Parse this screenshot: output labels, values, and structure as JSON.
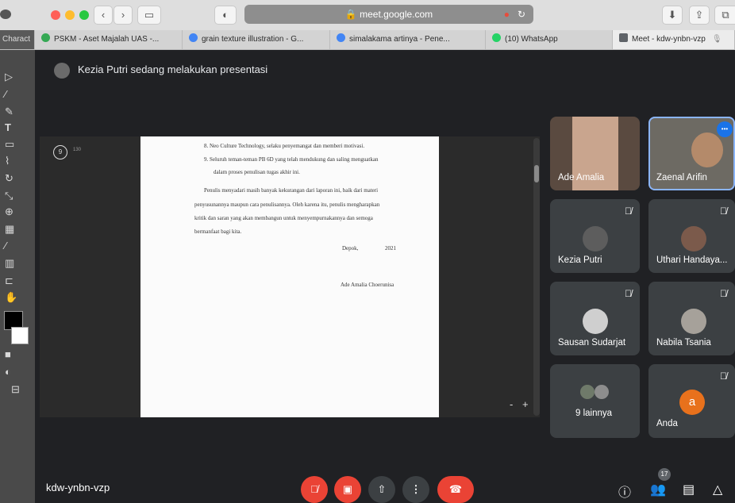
{
  "browser": {
    "url": "meet.google.com",
    "tabs": [
      {
        "label": "PSKM - Aset Majalah UAS -...",
        "icon": "drive-icon",
        "color": "#34a853"
      },
      {
        "label": "grain texture illustration - G...",
        "icon": "google-icon",
        "color": "#4285f4"
      },
      {
        "label": "simalakama artinya - Pene...",
        "icon": "google-icon",
        "color": "#4285f4"
      },
      {
        "label": "(10) WhatsApp",
        "icon": "whatsapp-icon",
        "color": "#25d366"
      },
      {
        "label": "Meet - kdw-ynbn-vzp",
        "icon": "meet-icon",
        "color": "#5f6368"
      }
    ],
    "left_partial_label": "Charact"
  },
  "meet": {
    "presenter_text": "Kezia Putri sedang melakukan presentasi",
    "meeting_code": "kdw-ynbn-vzp",
    "participants_count": "17",
    "presentation": {
      "page_number": "9",
      "page_total": "130",
      "zoom_minus": "-",
      "zoom_plus": "+",
      "lines": [
        "8.   Neo Culture Technology, selaku penyemangat dan memberi motivasi.",
        "9.   Seluruh teman-teman PB 6D yang telah mendukung dan saling menguatkan",
        "dalam proses penulisan tugas akhir ini.",
        "Penulis menyadari masih banyak kekurangan dari laporan ini, baik dari materi",
        "penyusunannya maupun cara penulisannya. Oleh karena itu, penulis mengharapkan",
        "kritik dan saran yang akan membangun untuk menyempurnakannya dan semoga",
        "bermanfaat bagi kita.",
        "Depok,",
        "2021",
        "Ade Amalia Choerunisa"
      ]
    },
    "tiles": [
      {
        "name": "Ade Amalia",
        "muted": false
      },
      {
        "name": "Zaenal Arifin",
        "muted": false
      },
      {
        "name": "Kezia Putri",
        "muted": true
      },
      {
        "name": "Uthari Handaya...",
        "muted": true
      },
      {
        "name": "Sausan Sudarjat",
        "muted": true
      },
      {
        "name": "Nabila Tsania",
        "muted": true
      },
      {
        "name": "9 lainnya",
        "muted": false
      },
      {
        "name": "Anda",
        "muted": true,
        "avatar_letter": "a"
      }
    ],
    "more_options_label": "•••"
  }
}
